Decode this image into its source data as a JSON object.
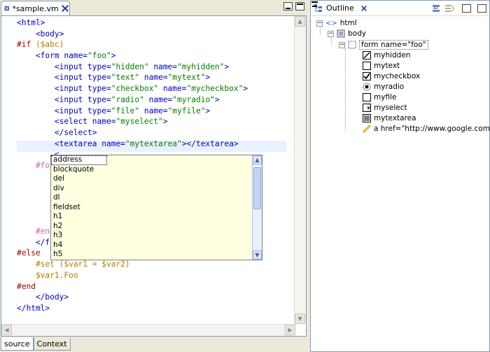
{
  "editor": {
    "tab_title": "*sample.vm",
    "code_lines": [
      [
        {
          "t": "<html>",
          "c": "#0000c0"
        }
      ],
      [
        {
          "t": "    <body>",
          "c": "#0000c0"
        }
      ],
      [
        {
          "t": "#if ",
          "c": "#a00000"
        },
        {
          "t": "($abc)",
          "c": "#b08000"
        }
      ],
      [
        {
          "t": "    <form ",
          "c": "#0000c0"
        },
        {
          "t": "name=",
          "c": "#0000c0"
        },
        {
          "t": "\"foo\"",
          "c": "#008000"
        },
        {
          "t": ">",
          "c": "#0000c0"
        }
      ],
      [
        {
          "t": "        <input type=",
          "c": "#0000c0"
        },
        {
          "t": "\"hidden\"",
          "c": "#008000"
        },
        {
          "t": " name=",
          "c": "#0000c0"
        },
        {
          "t": "\"myhidden\"",
          "c": "#008000"
        },
        {
          "t": ">",
          "c": "#0000c0"
        }
      ],
      [
        {
          "t": "        <input type=",
          "c": "#0000c0"
        },
        {
          "t": "\"text\"",
          "c": "#008000"
        },
        {
          "t": " name=",
          "c": "#0000c0"
        },
        {
          "t": "\"mytext\"",
          "c": "#008000"
        },
        {
          "t": ">",
          "c": "#0000c0"
        }
      ],
      [
        {
          "t": "        <input type=",
          "c": "#0000c0"
        },
        {
          "t": "\"checkbox\"",
          "c": "#008000"
        },
        {
          "t": " name=",
          "c": "#0000c0"
        },
        {
          "t": "\"mycheckbox\"",
          "c": "#008000"
        },
        {
          "t": ">",
          "c": "#0000c0"
        }
      ],
      [
        {
          "t": "        <input type=",
          "c": "#0000c0"
        },
        {
          "t": "\"radio\"",
          "c": "#008000"
        },
        {
          "t": " name=",
          "c": "#0000c0"
        },
        {
          "t": "\"myradio\"",
          "c": "#008000"
        },
        {
          "t": ">",
          "c": "#0000c0"
        }
      ],
      [
        {
          "t": "        <input type=",
          "c": "#0000c0"
        },
        {
          "t": "\"file\"",
          "c": "#008000"
        },
        {
          "t": " name=",
          "c": "#0000c0"
        },
        {
          "t": "\"myfile\"",
          "c": "#008000"
        },
        {
          "t": ">",
          "c": "#0000c0"
        }
      ],
      [
        {
          "t": "        <select name=",
          "c": "#0000c0"
        },
        {
          "t": "\"myselect\"",
          "c": "#008000"
        },
        {
          "t": ">",
          "c": "#0000c0"
        }
      ],
      [
        {
          "t": "        </select>",
          "c": "#0000c0"
        }
      ],
      [
        {
          "t": "        <textarea name=",
          "c": "#0000c0"
        },
        {
          "t": "\"mytextarea\"",
          "c": "#008000"
        },
        {
          "t": "></textarea>",
          "c": "#0000c0"
        }
      ],
      [
        {
          "t": "        <",
          "c": "#0000c0"
        }
      ],
      [
        {
          "t": "    #fore",
          "c": "#e060a0"
        }
      ],
      [
        {
          "t": "        #",
          "c": "#a00000"
        }
      ],
      [
        {
          "t": "",
          "c": "#000"
        }
      ],
      [
        {
          "t": "        #",
          "c": "#a00000"
        }
      ],
      [
        {
          "t": "",
          "c": "#000"
        }
      ],
      [
        {
          "t": "        #",
          "c": "#a00000"
        }
      ],
      [
        {
          "t": "    #end",
          "c": "#e060a0"
        }
      ],
      [
        {
          "t": "    </for",
          "c": "#0000c0"
        }
      ],
      [
        {
          "t": "#else",
          "c": "#a00000"
        }
      ],
      [
        {
          "t": "    #set ($var1 = $var2)",
          "c": "#b08000"
        }
      ],
      [
        {
          "t": "    $var1.Foo",
          "c": "#b08000"
        }
      ],
      [
        {
          "t": "#end",
          "c": "#a00000"
        }
      ],
      [
        {
          "t": "    </body>",
          "c": "#0000c0"
        }
      ],
      [
        {
          "t": "</html>",
          "c": "#0000c0"
        }
      ]
    ],
    "bottom_tabs": [
      "source",
      "Context"
    ]
  },
  "completion": {
    "items": [
      "address",
      "blockquote",
      "del",
      "div",
      "dl",
      "fieldset",
      "h1",
      "h2",
      "h3",
      "h4",
      "h5"
    ],
    "selected": "address"
  },
  "outline": {
    "title": "Outline",
    "nodes": {
      "html": "html",
      "body": "body",
      "form": "form name=\"foo\"",
      "myhidden": "myhidden",
      "mytext": "mytext",
      "mycheckbox": "mycheckbox",
      "myradio": "myradio",
      "myfile": "myfile",
      "myselect": "myselect",
      "mytextarea": "mytextarea",
      "link": "a href=\"http://www.google.com\""
    }
  }
}
